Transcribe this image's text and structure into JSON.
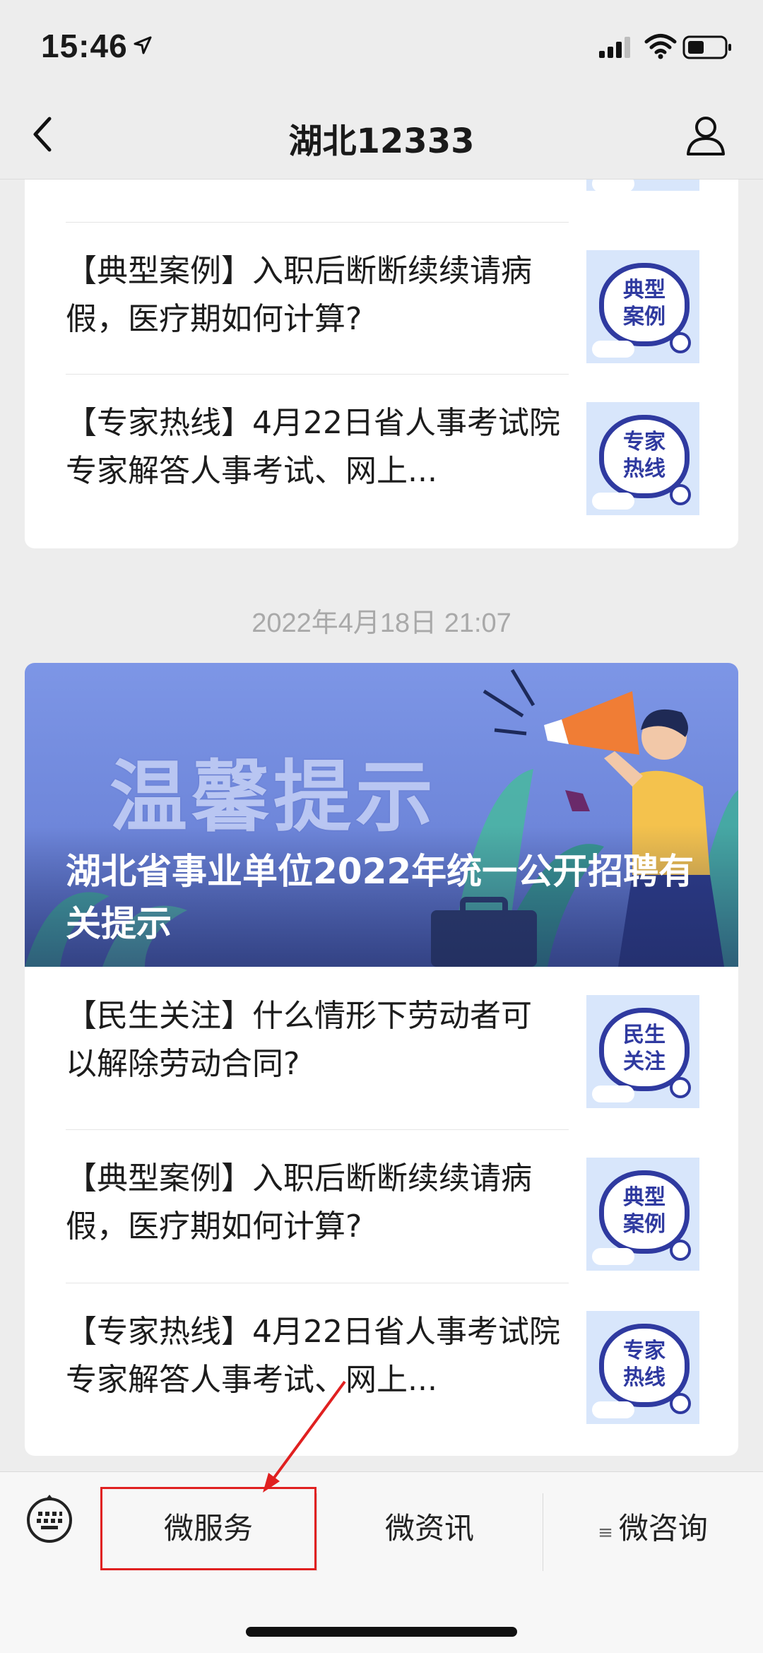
{
  "status_bar": {
    "time": "15:46"
  },
  "nav": {
    "title": "湖北12333"
  },
  "card1": {
    "items": [
      {
        "text": "【典型案例】入职后断断续续请病假，医疗期如何计算?",
        "thumb_lines": [
          "典型",
          "案例"
        ]
      },
      {
        "text": "【专家热线】4月22日省人事考试院专家解答人事考试、网上...",
        "thumb_lines": [
          "专家",
          "热线"
        ]
      }
    ]
  },
  "timestamp": "2022年4月18日 21:07",
  "card2": {
    "banner_big_text": "温馨提示",
    "banner_title": "湖北省事业单位2022年统一公开招聘有关提示",
    "items": [
      {
        "text": "【民生关注】什么情形下劳动者可以解除劳动合同?",
        "thumb_lines": [
          "民生",
          "关注"
        ]
      },
      {
        "text": "【典型案例】入职后断断续续请病假，医疗期如何计算?",
        "thumb_lines": [
          "典型",
          "案例"
        ]
      },
      {
        "text": "【专家热线】4月22日省人事考试院专家解答人事考试、网上...",
        "thumb_lines": [
          "专家",
          "热线"
        ]
      }
    ]
  },
  "menu": {
    "item1": "微服务",
    "item2": "微资讯",
    "item3_prefix": "≡",
    "item3": "微咨询"
  },
  "colors": {
    "annotation": "#e02020",
    "thumb_blue": "#2f3aa0"
  },
  "icons": [
    "location-arrow-icon",
    "signal-icon",
    "wifi-icon",
    "battery-icon",
    "back-arrow-icon",
    "profile-icon",
    "keyboard-icon"
  ]
}
